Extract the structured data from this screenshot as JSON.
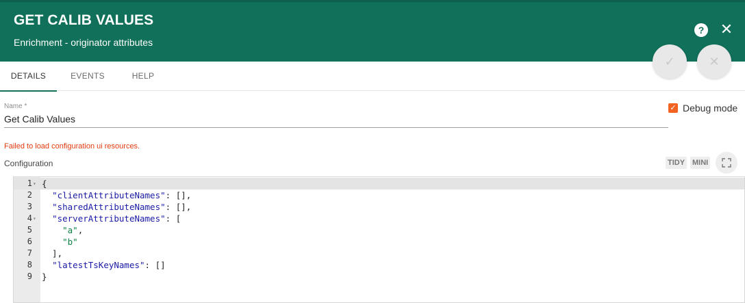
{
  "header": {
    "title": "GET CALIB VALUES",
    "subtitle": "Enrichment - originator attributes",
    "help_symbol": "?",
    "close_symbol": "✕",
    "bg_color": "#11705a"
  },
  "fab": {
    "save_symbol": "✓",
    "cancel_symbol": "✕"
  },
  "tabs": [
    {
      "label": "DETAILS",
      "active": true
    },
    {
      "label": "EVENTS",
      "active": false
    },
    {
      "label": "HELP",
      "active": false
    }
  ],
  "form": {
    "name_label": "Name *",
    "name_value": "Get Calib Values",
    "debug_label": "Debug mode",
    "debug_checked": true,
    "debug_check_symbol": "✓",
    "error_text": "Failed to load configuration ui resources.",
    "config_label": "Configuration",
    "tidy_label": "TIDY",
    "mini_label": "MINI"
  },
  "editor": {
    "lines": [
      {
        "num": "1",
        "fold": "▾",
        "text": "{"
      },
      {
        "num": "2",
        "fold": "",
        "text": "  \"clientAttributeNames\": [],"
      },
      {
        "num": "3",
        "fold": "",
        "text": "  \"sharedAttributeNames\": [],"
      },
      {
        "num": "4",
        "fold": "▾",
        "text": "  \"serverAttributeNames\": ["
      },
      {
        "num": "5",
        "fold": "",
        "text": "    \"a\","
      },
      {
        "num": "6",
        "fold": "",
        "text": "    \"b\""
      },
      {
        "num": "7",
        "fold": "",
        "text": "  ],"
      },
      {
        "num": "8",
        "fold": "",
        "text": "  \"latestTsKeyNames\": []"
      },
      {
        "num": "9",
        "fold": "",
        "text": "}"
      }
    ]
  },
  "icons": {
    "help": "help-icon",
    "close": "close-icon",
    "save": "check-icon",
    "cancel": "cancel-icon",
    "fullscreen": "fullscreen-icon",
    "debug_checkbox": "checkbox-icon"
  },
  "colors": {
    "accent": "#11705a",
    "error": "#e53a0e",
    "checkbox": "#f26322"
  }
}
